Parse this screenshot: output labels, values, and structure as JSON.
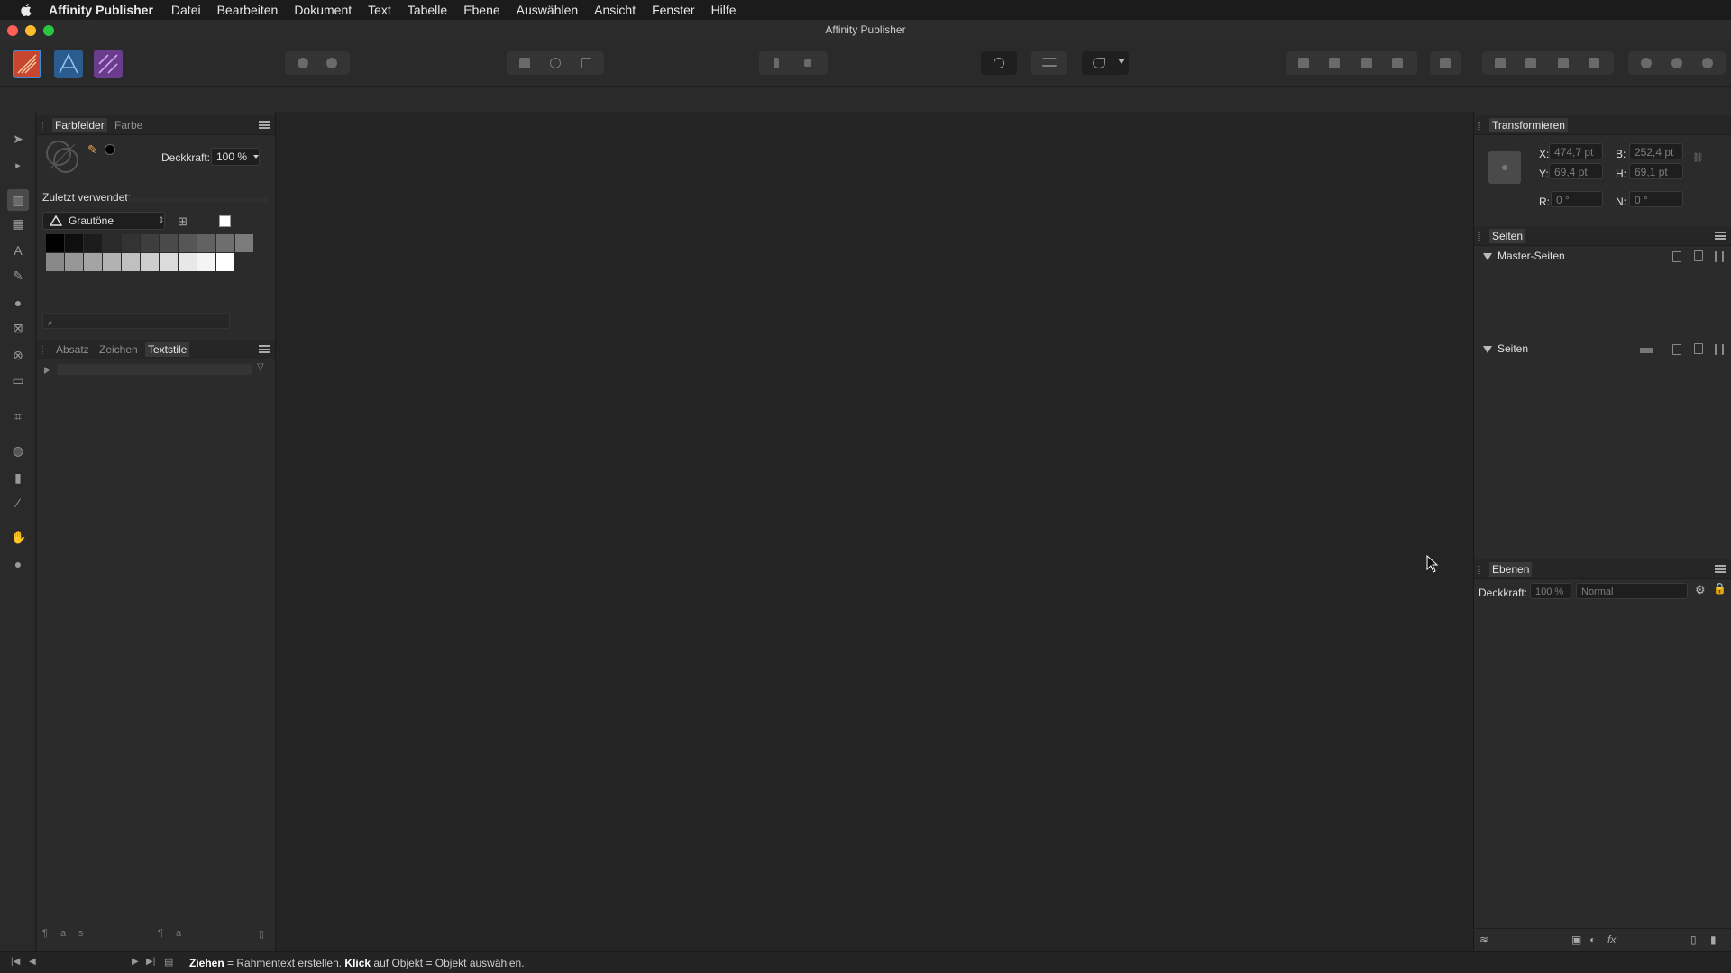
{
  "menubar": {
    "app_name": "Affinity Publisher",
    "items": [
      "Datei",
      "Bearbeiten",
      "Dokument",
      "Text",
      "Tabelle",
      "Ebene",
      "Auswählen",
      "Ansicht",
      "Fenster",
      "Hilfe"
    ]
  },
  "window": {
    "title": "Affinity Publisher"
  },
  "colors": {
    "accent": "#3a8bd8",
    "publisher_persona": "#c8452f",
    "designer_persona": "#3d7ec1",
    "photo_persona": "#8a4fb3"
  },
  "swatches_panel": {
    "tabs": [
      "Farbfelder",
      "Farbe"
    ],
    "active_tab": "Farbfelder",
    "opacity_label": "Deckkraft:",
    "opacity_value": "100 %",
    "recent_label": "Zuletzt verwendet:",
    "palette_name": "Grautöne",
    "gray_row1": [
      "#000000",
      "#0f0f0f",
      "#1c1c1c",
      "#2a2a2a",
      "#333333",
      "#3e3e3e",
      "#4a4a4a",
      "#565656",
      "#626262",
      "#6e6e6e",
      "#7b7b7b"
    ],
    "gray_row2": [
      "#898989",
      "#979797",
      "#a4a4a4",
      "#b2b2b2",
      "#c0c0c0",
      "#cdcdcd",
      "#dbdbdb",
      "#e8e8e8",
      "#f4f4f4",
      "#ffffff"
    ]
  },
  "styles_panel": {
    "tabs": [
      "Absatz",
      "Zeichen",
      "Textstile"
    ],
    "active_tab": "Textstile"
  },
  "transform_panel": {
    "title": "Transformieren",
    "x_label": "X:",
    "x_value": "474,7 pt",
    "y_label": "Y:",
    "y_value": "69,4 pt",
    "w_label": "B:",
    "w_value": "252,4 pt",
    "h_label": "H:",
    "h_value": "69,1 pt",
    "r_label": "R:",
    "r_value": "0 °",
    "n_label": "N:",
    "n_value": "0 °"
  },
  "pages_panel": {
    "title": "Seiten",
    "master_label": "Master-Seiten",
    "pages_label": "Seiten"
  },
  "layers_panel": {
    "title": "Ebenen",
    "opacity_label": "Deckkraft:",
    "opacity_value": "100 %",
    "blend_mode": "Normal"
  },
  "status": {
    "drag_word": "Ziehen",
    "drag_text": " = Rahmentext erstellen. ",
    "click_word": "Klick",
    "click_text": " auf Objekt = Objekt auswählen."
  }
}
